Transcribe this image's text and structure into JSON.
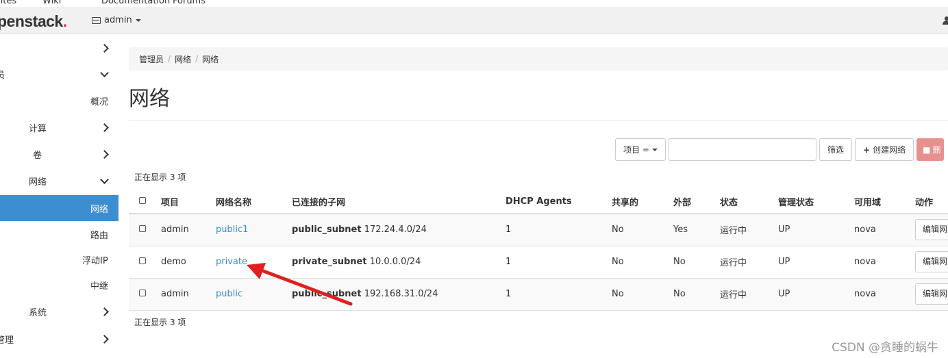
{
  "bookmarks": [
    "ntes",
    "Wiki",
    "Documentation",
    "Forums"
  ],
  "brand": {
    "text": "penstack",
    "dot": "."
  },
  "project_menu": {
    "label": "admin"
  },
  "sidebar": {
    "items": [
      {
        "label": ""
      },
      {
        "label": "员"
      },
      {
        "label": "概况"
      },
      {
        "label": "计算"
      },
      {
        "label": "卷"
      },
      {
        "label": "网络"
      },
      {
        "label": "网络"
      },
      {
        "label": "路由"
      },
      {
        "label": "浮动IP"
      },
      {
        "label": "中继"
      },
      {
        "label": "系统"
      },
      {
        "label": "管理"
      }
    ]
  },
  "breadcrumb": [
    "管理员",
    "网络",
    "网络"
  ],
  "page_title": "网络",
  "toolbar": {
    "filter_select": "项目 =",
    "filter_value": "",
    "filter_button": "筛选",
    "create_button": "创建网络",
    "delete_button": "删"
  },
  "count_text": "正在显示 3 项",
  "table": {
    "headers": [
      "项目",
      "网络名称",
      "已连接的子网",
      "DHCP Agents",
      "共享的",
      "外部",
      "状态",
      "管理状态",
      "可用域",
      "动作"
    ],
    "rows": [
      {
        "project": "admin",
        "name": "public1",
        "subnet_name": "public_subnet",
        "subnet_cidr": "172.24.4.0/24",
        "dhcp": "1",
        "shared": "No",
        "external": "Yes",
        "status": "运行中",
        "admin_state": "UP",
        "az": "nova",
        "action": "编辑网"
      },
      {
        "project": "demo",
        "name": "private",
        "subnet_name": "private_subnet",
        "subnet_cidr": "10.0.0.0/24",
        "dhcp": "1",
        "shared": "No",
        "external": "No",
        "status": "运行中",
        "admin_state": "UP",
        "az": "nova",
        "action": "编辑网"
      },
      {
        "project": "admin",
        "name": "public",
        "subnet_name": "public_subnet",
        "subnet_cidr": "192.168.31.0/24",
        "dhcp": "1",
        "shared": "No",
        "external": "No",
        "status": "运行中",
        "admin_state": "UP",
        "az": "nova",
        "action": "编辑网"
      }
    ]
  },
  "watermark": "CSDN @贪睡的蜗牛",
  "colors": {
    "accent": "#3d8ed1",
    "arrow": "#e02020",
    "danger_button": "#e8908e"
  }
}
